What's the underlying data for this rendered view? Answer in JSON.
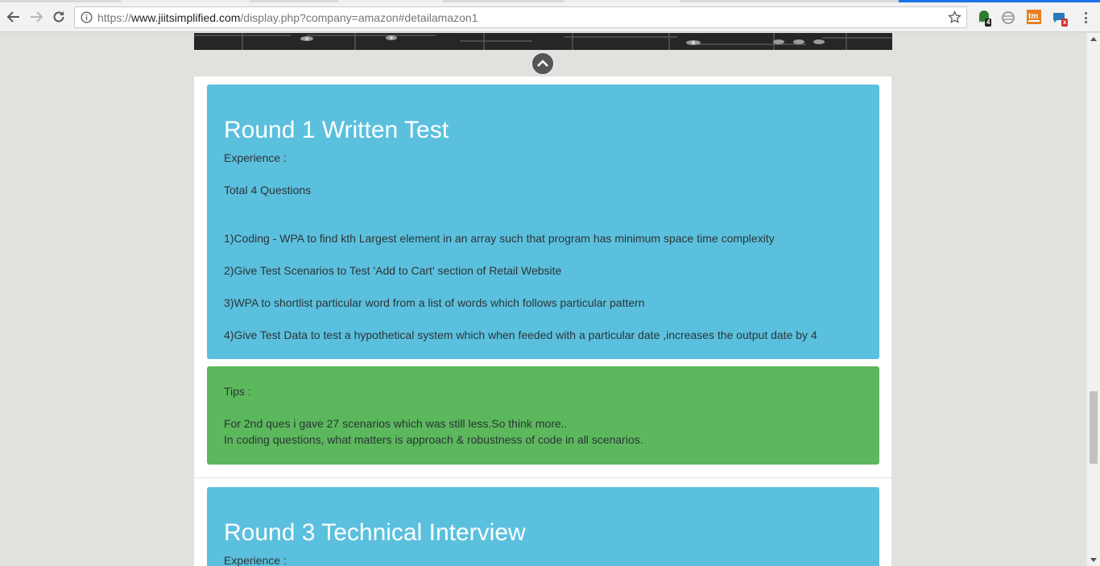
{
  "browser": {
    "url_scheme": "https://",
    "url_host": "www.jiitsimplified.com",
    "url_path": "/display.php?company=amazon#detailamazon1",
    "extensions": [
      {
        "name": "ghostery-icon",
        "badge": "4",
        "color": "#2e7d32"
      },
      {
        "name": "globe-extension-icon",
        "badge": "",
        "color": "#9e9e9e"
      },
      {
        "name": "tm-extension-icon",
        "label": "tm",
        "color": "#e67e22"
      },
      {
        "name": "chat-extension-icon",
        "badge": "x",
        "color": "#2a7ab8"
      }
    ],
    "accent_color": "#1a73e8"
  },
  "cards": [
    {
      "type": "round",
      "title": "Round 1 Written Test",
      "lines": [
        "Experience :",
        "Total 4 Questions",
        "1)Coding - WPA to find kth Largest element in an array such that program has minimum space time complexity",
        "2)Give Test Scenarios to Test 'Add to Cart' section of Retail Website",
        "3)WPA to shortlist particular word from a list of words which follows particular pattern",
        "4)Give Test Data to test a hypothetical system which when feeded with a particular date ,increases the output date by 4"
      ],
      "color": "#5bc0de"
    },
    {
      "type": "tips",
      "lines": [
        "Tips :",
        "For 2nd ques i gave 27 scenarios which was still less.So think more..",
        "In coding questions, what matters is approach & robustness of code in all scenarios."
      ],
      "color": "#5cb85c"
    },
    {
      "type": "round",
      "title": "Round 3 Technical Interview",
      "lines": [
        "Experience :"
      ],
      "color": "#5bc0de"
    }
  ],
  "scroll_position": 0.67
}
